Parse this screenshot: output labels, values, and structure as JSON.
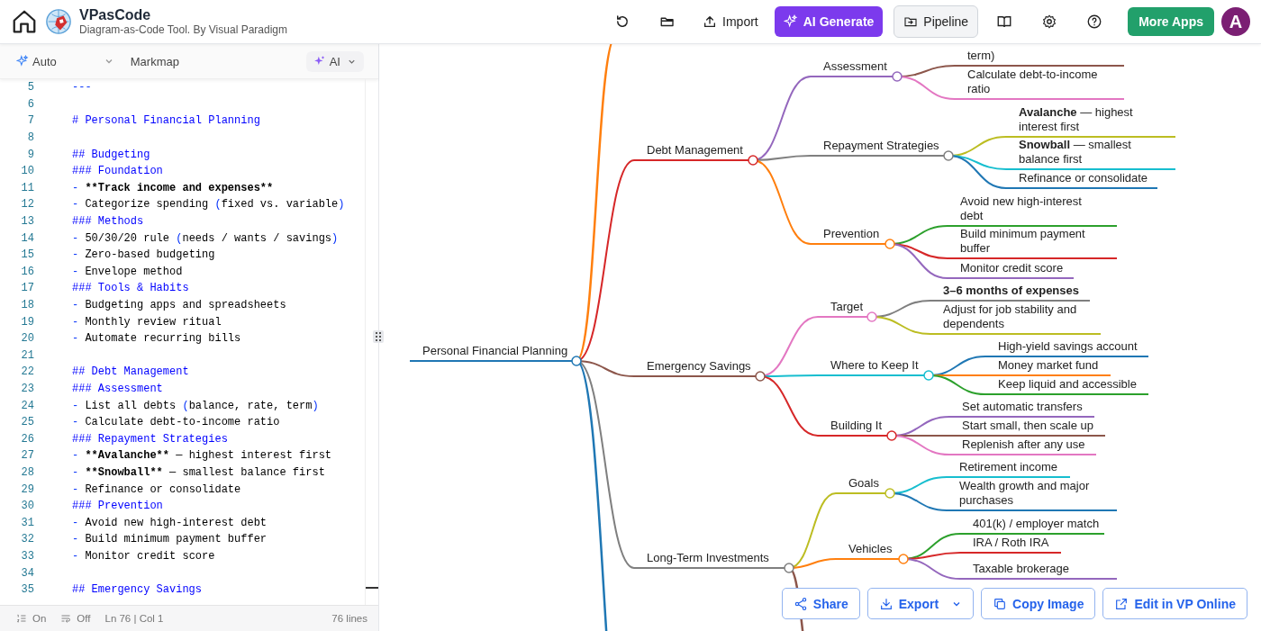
{
  "app": {
    "title": "VPasCode",
    "subtitle": "Diagram-as-Code Tool. By Visual Paradigm"
  },
  "toolbar": {
    "import": "Import",
    "ai_generate": "AI Generate",
    "pipeline": "Pipeline",
    "more_apps": "More Apps",
    "avatar": "A"
  },
  "editor_bar": {
    "mode": "Auto",
    "diagram_type": "Markmap",
    "ai": "AI"
  },
  "code_lines": [
    {
      "num": "5",
      "parts": [
        {
          "kind": "marker",
          "text": "---"
        }
      ]
    },
    {
      "num": "6"
    },
    {
      "num": "7",
      "parts": [
        {
          "kind": "heading",
          "text": "# Personal Financial Planning"
        }
      ]
    },
    {
      "num": "8"
    },
    {
      "num": "9",
      "parts": [
        {
          "kind": "heading",
          "text": "## Budgeting"
        }
      ]
    },
    {
      "num": "10",
      "parts": [
        {
          "kind": "heading",
          "text": "### Foundation"
        }
      ]
    },
    {
      "num": "11",
      "parts": [
        {
          "kind": "marker",
          "text": "- "
        },
        {
          "kind": "bold",
          "text": "**Track income and expenses**"
        }
      ]
    },
    {
      "num": "12",
      "parts": [
        {
          "kind": "marker",
          "text": "- "
        },
        {
          "kind": "plain",
          "text": "Categorize spending "
        },
        {
          "kind": "marker",
          "text": "("
        },
        {
          "kind": "plain",
          "text": "fixed vs. variable"
        },
        {
          "kind": "marker",
          "text": ")"
        }
      ]
    },
    {
      "num": "13",
      "parts": [
        {
          "kind": "heading",
          "text": "### Methods"
        }
      ]
    },
    {
      "num": "14",
      "parts": [
        {
          "kind": "marker",
          "text": "- "
        },
        {
          "kind": "plain",
          "text": "50/30/20 rule "
        },
        {
          "kind": "marker",
          "text": "("
        },
        {
          "kind": "plain",
          "text": "needs / wants / savings"
        },
        {
          "kind": "marker",
          "text": ")"
        }
      ]
    },
    {
      "num": "15",
      "parts": [
        {
          "kind": "marker",
          "text": "- "
        },
        {
          "kind": "plain",
          "text": "Zero-based budgeting"
        }
      ]
    },
    {
      "num": "16",
      "parts": [
        {
          "kind": "marker",
          "text": "- "
        },
        {
          "kind": "plain",
          "text": "Envelope method"
        }
      ]
    },
    {
      "num": "17",
      "parts": [
        {
          "kind": "heading",
          "text": "### Tools & Habits"
        }
      ]
    },
    {
      "num": "18",
      "parts": [
        {
          "kind": "marker",
          "text": "- "
        },
        {
          "kind": "plain",
          "text": "Budgeting apps and spreadsheets"
        }
      ]
    },
    {
      "num": "19",
      "parts": [
        {
          "kind": "marker",
          "text": "- "
        },
        {
          "kind": "plain",
          "text": "Monthly review ritual"
        }
      ]
    },
    {
      "num": "20",
      "parts": [
        {
          "kind": "marker",
          "text": "- "
        },
        {
          "kind": "plain",
          "text": "Automate recurring bills"
        }
      ]
    },
    {
      "num": "21"
    },
    {
      "num": "22",
      "parts": [
        {
          "kind": "heading",
          "text": "## Debt Management"
        }
      ]
    },
    {
      "num": "23",
      "parts": [
        {
          "kind": "heading",
          "text": "### Assessment"
        }
      ]
    },
    {
      "num": "24",
      "parts": [
        {
          "kind": "marker",
          "text": "- "
        },
        {
          "kind": "plain",
          "text": "List all debts "
        },
        {
          "kind": "marker",
          "text": "("
        },
        {
          "kind": "plain",
          "text": "balance, rate, term"
        },
        {
          "kind": "marker",
          "text": ")"
        }
      ]
    },
    {
      "num": "25",
      "parts": [
        {
          "kind": "marker",
          "text": "- "
        },
        {
          "kind": "plain",
          "text": "Calculate debt-to-income ratio"
        }
      ]
    },
    {
      "num": "26",
      "parts": [
        {
          "kind": "heading",
          "text": "### Repayment Strategies"
        }
      ]
    },
    {
      "num": "27",
      "parts": [
        {
          "kind": "marker",
          "text": "- "
        },
        {
          "kind": "bold",
          "text": "**Avalanche**"
        },
        {
          "kind": "plain",
          "text": " — highest interest first"
        }
      ]
    },
    {
      "num": "28",
      "parts": [
        {
          "kind": "marker",
          "text": "- "
        },
        {
          "kind": "bold",
          "text": "**Snowball**"
        },
        {
          "kind": "plain",
          "text": " — smallest balance first"
        }
      ]
    },
    {
      "num": "29",
      "parts": [
        {
          "kind": "marker",
          "text": "- "
        },
        {
          "kind": "plain",
          "text": "Refinance or consolidate"
        }
      ]
    },
    {
      "num": "30",
      "parts": [
        {
          "kind": "heading",
          "text": "### Prevention"
        }
      ]
    },
    {
      "num": "31",
      "parts": [
        {
          "kind": "marker",
          "text": "- "
        },
        {
          "kind": "plain",
          "text": "Avoid new high-interest debt"
        }
      ]
    },
    {
      "num": "32",
      "parts": [
        {
          "kind": "marker",
          "text": "- "
        },
        {
          "kind": "plain",
          "text": "Build minimum payment buffer"
        }
      ]
    },
    {
      "num": "33",
      "parts": [
        {
          "kind": "marker",
          "text": "- "
        },
        {
          "kind": "plain",
          "text": "Monitor credit score"
        }
      ]
    },
    {
      "num": "34"
    },
    {
      "num": "35",
      "parts": [
        {
          "kind": "heading",
          "text": "## Emergency Savings"
        }
      ]
    }
  ],
  "status_bar": {
    "line_numbers": "On",
    "word_wrap": "Off",
    "cursor": "Ln 76 | Col 1",
    "line_count": "76 lines"
  },
  "mindmap": {
    "label": "Personal Financial Planning",
    "color": "#1f77b4",
    "children": [
      {
        "color": "#ff7f0e"
      },
      {
        "label": "Debt Management",
        "color": "#d62728",
        "children": [
          {
            "label": "Assessment",
            "color": "#9467bd",
            "children": [
              {
                "label": "term)",
                "color": "#8c564b"
              },
              {
                "label": "Calculate debt-to-income ratio",
                "color": "#e377c2"
              }
            ]
          },
          {
            "label": "Repayment Strategies",
            "color": "#7f7f7f",
            "children": [
              {
                "label": "**Avalanche** — highest interest first",
                "color": "#bcbd22"
              },
              {
                "label": "**Snowball** — smallest balance first",
                "color": "#17becf"
              },
              {
                "label": "Refinance or consolidate",
                "color": "#1f77b4"
              }
            ]
          },
          {
            "label": "Prevention",
            "color": "#ff7f0e",
            "children": [
              {
                "label": "Avoid new high-interest debt",
                "color": "#2ca02c"
              },
              {
                "label": "Build minimum payment buffer",
                "color": "#d62728"
              },
              {
                "label": "Monitor credit score",
                "color": "#9467bd"
              }
            ]
          }
        ]
      },
      {
        "label": "Emergency Savings",
        "color": "#8c564b",
        "children": [
          {
            "label": "Target",
            "color": "#e377c2",
            "children": [
              {
                "label": "**3–6 months of expenses**",
                "color": "#7f7f7f"
              },
              {
                "label": "Adjust for job stability and dependents",
                "color": "#bcbd22"
              }
            ]
          },
          {
            "label": "Where to Keep It",
            "color": "#17becf",
            "children": [
              {
                "label": "High-yield savings account",
                "color": "#1f77b4"
              },
              {
                "label": "Money market fund",
                "color": "#ff7f0e"
              },
              {
                "label": "Keep liquid and accessible",
                "color": "#2ca02c"
              }
            ]
          },
          {
            "label": "Building It",
            "color": "#d62728",
            "children": [
              {
                "label": "Set automatic transfers",
                "color": "#9467bd"
              },
              {
                "label": "Start small, then scale up",
                "color": "#8c564b"
              },
              {
                "label": "Replenish after any use",
                "color": "#e377c2"
              }
            ]
          }
        ]
      },
      {
        "label": "Long-Term Investments",
        "color": "#7f7f7f",
        "children": [
          {
            "label": "Goals",
            "color": "#bcbd22",
            "children": [
              {
                "label": "Retirement income",
                "color": "#17becf"
              },
              {
                "label": "Wealth growth and major purchases",
                "color": "#1f77b4"
              }
            ]
          },
          {
            "label": "Vehicles",
            "color": "#ff7f0e",
            "children": [
              {
                "label": "401(k) / employer match",
                "color": "#2ca02c"
              },
              {
                "label": "IRA / Roth IRA",
                "color": "#d62728"
              },
              {
                "label": "Taxable brokerage",
                "color": "#9467bd"
              }
            ]
          },
          {
            "color": "#8c564b"
          }
        ]
      },
      {
        "color": "#1f77b4"
      }
    ]
  },
  "actions": {
    "share": "Share",
    "export": "Export",
    "copy_image": "Copy Image",
    "edit_online": "Edit in VP Online"
  }
}
